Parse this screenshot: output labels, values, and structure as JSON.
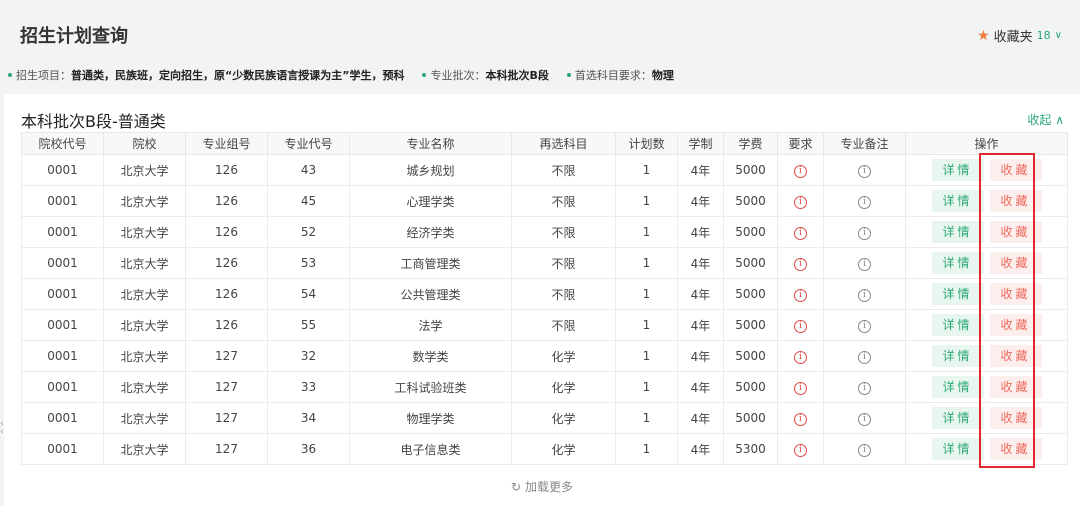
{
  "header": {
    "title": "招生计划查询",
    "favorites_label": "收藏夹",
    "favorites_count": "18",
    "star_icon": "star-icon",
    "chevron_icon": "chevron-down-icon"
  },
  "filters": [
    {
      "label": "招生项目：",
      "value": "普通类，民族班，定向招生，原“少数民族语言授课为主”学生，预科"
    },
    {
      "label": "专业批次：",
      "value": "本科批次B段"
    },
    {
      "label": "首选科目要求：",
      "value": "物理"
    }
  ],
  "section": {
    "title": "本科批次B段-普通类",
    "collapse_label": "收起 ∧"
  },
  "table": {
    "headers": [
      "院校代号",
      "院校",
      "专业组号",
      "专业代号",
      "专业名称",
      "再选科目",
      "计划数",
      "学制",
      "学费",
      "要求",
      "专业备注",
      "操作"
    ],
    "rows": [
      [
        "0001",
        "北京大学",
        "126",
        "43",
        "城乡规划",
        "不限",
        "1",
        "4年",
        "5000"
      ],
      [
        "0001",
        "北京大学",
        "126",
        "45",
        "心理学类",
        "不限",
        "1",
        "4年",
        "5000"
      ],
      [
        "0001",
        "北京大学",
        "126",
        "52",
        "经济学类",
        "不限",
        "1",
        "4年",
        "5000"
      ],
      [
        "0001",
        "北京大学",
        "126",
        "53",
        "工商管理类",
        "不限",
        "1",
        "4年",
        "5000"
      ],
      [
        "0001",
        "北京大学",
        "126",
        "54",
        "公共管理类",
        "不限",
        "1",
        "4年",
        "5000"
      ],
      [
        "0001",
        "北京大学",
        "126",
        "55",
        "法学",
        "不限",
        "1",
        "4年",
        "5000"
      ],
      [
        "0001",
        "北京大学",
        "127",
        "32",
        "数学类",
        "化学",
        "1",
        "4年",
        "5000"
      ],
      [
        "0001",
        "北京大学",
        "127",
        "33",
        "工科试验班类",
        "化学",
        "1",
        "4年",
        "5000"
      ],
      [
        "0001",
        "北京大学",
        "127",
        "34",
        "物理学类",
        "化学",
        "1",
        "4年",
        "5000"
      ],
      [
        "0001",
        "北京大学",
        "127",
        "36",
        "电子信息类",
        "化学",
        "1",
        "4年",
        "5300"
      ]
    ],
    "detail_label": "详情",
    "collect_label": "收藏"
  },
  "load_more": "加载更多",
  "colors": {
    "accent_green": "#2aa876",
    "collect_red": "#ee6a5c",
    "highlight_red": "#e0262e",
    "star_orange": "#f07d3c"
  }
}
